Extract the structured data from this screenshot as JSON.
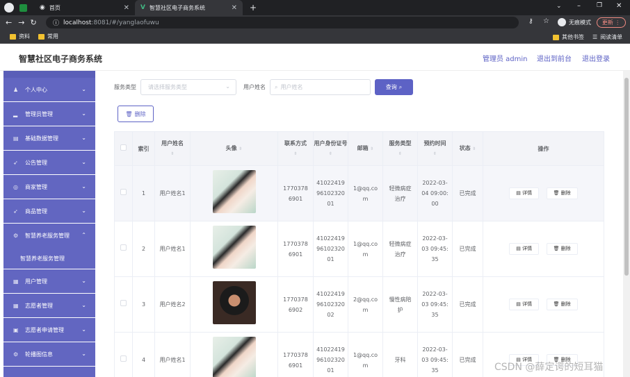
{
  "browser": {
    "tabs": [
      {
        "title": "首页",
        "active": false
      },
      {
        "title": "智慧社区电子商务系统",
        "active": true
      }
    ],
    "url_host": "localhost",
    "url_path": ":8081/#/yanglaofuwu",
    "incognito_label": "无痕模式",
    "update_label": "更新",
    "bookmarks": [
      "资料",
      "常用"
    ],
    "other_bookmarks": "其他书签",
    "reading_list": "阅读清单"
  },
  "header": {
    "title": "智慧社区电子商务系统",
    "user": "管理员 admin",
    "to_front": "退出到前台",
    "logout": "退出登录"
  },
  "sidebar": {
    "items": [
      {
        "label": "个人中心",
        "icon": "user-icon"
      },
      {
        "label": "管理员管理",
        "icon": "chart-icon"
      },
      {
        "label": "基础数据管理",
        "icon": "bank-icon"
      },
      {
        "label": "公告管理",
        "icon": "send-icon"
      },
      {
        "label": "商家管理",
        "icon": "globe-icon"
      },
      {
        "label": "商品管理",
        "icon": "send-icon"
      },
      {
        "label": "智慧养老服务管理",
        "icon": "settings-icon",
        "expanded": true
      },
      {
        "label": "用户管理",
        "icon": "doc-icon"
      },
      {
        "label": "志愿者管理",
        "icon": "grid-icon"
      },
      {
        "label": "志愿者申请管理",
        "icon": "image-icon"
      },
      {
        "label": "轮播图信息",
        "icon": "settings-icon"
      }
    ],
    "submenu": "智慧养老服务管理"
  },
  "search": {
    "service_type_label": "服务类型",
    "service_type_placeholder": "请选择服务类型",
    "username_label": "用户姓名",
    "username_placeholder": "用户姓名",
    "query_button": "查询"
  },
  "delete_button": "删除",
  "table": {
    "headers": {
      "index": "索引",
      "name": "用户姓名",
      "avatar": "头像",
      "phone": "联系方式",
      "idcard": "用户身份证号",
      "email": "邮箱",
      "service": "服务类型",
      "time": "预约时间",
      "status": "状态",
      "ops": "操作"
    },
    "detail_label": "详情",
    "delete_label": "删除",
    "rows": [
      {
        "index": "1",
        "name": "用户姓名1",
        "avatar": "woman",
        "phone": "17703786901",
        "idcard": "410224199610232001",
        "email": "1@qq.com",
        "service": "轻微病症治疗",
        "time": "2022-03-04 09:00:00",
        "status": "已完成"
      },
      {
        "index": "2",
        "name": "用户姓名1",
        "avatar": "woman",
        "phone": "17703786901",
        "idcard": "410224199610232001",
        "email": "1@qq.com",
        "service": "轻微病症治疗",
        "time": "2022-03-03 09:45:35",
        "status": "已完成"
      },
      {
        "index": "3",
        "name": "用户姓名2",
        "avatar": "man",
        "phone": "17703786902",
        "idcard": "410224199610232002",
        "email": "2@qq.com",
        "service": "慢性病陪护",
        "time": "2022-03-03 09:45:35",
        "status": "已完成"
      },
      {
        "index": "4",
        "name": "用户姓名1",
        "avatar": "woman",
        "phone": "17703786901",
        "idcard": "410224199610232001",
        "email": "1@qq.com",
        "service": "牙科",
        "time": "2022-03-03 09:45:35",
        "status": "已完成"
      }
    ]
  },
  "watermark": "CSDN @薛定谔的短耳猫"
}
